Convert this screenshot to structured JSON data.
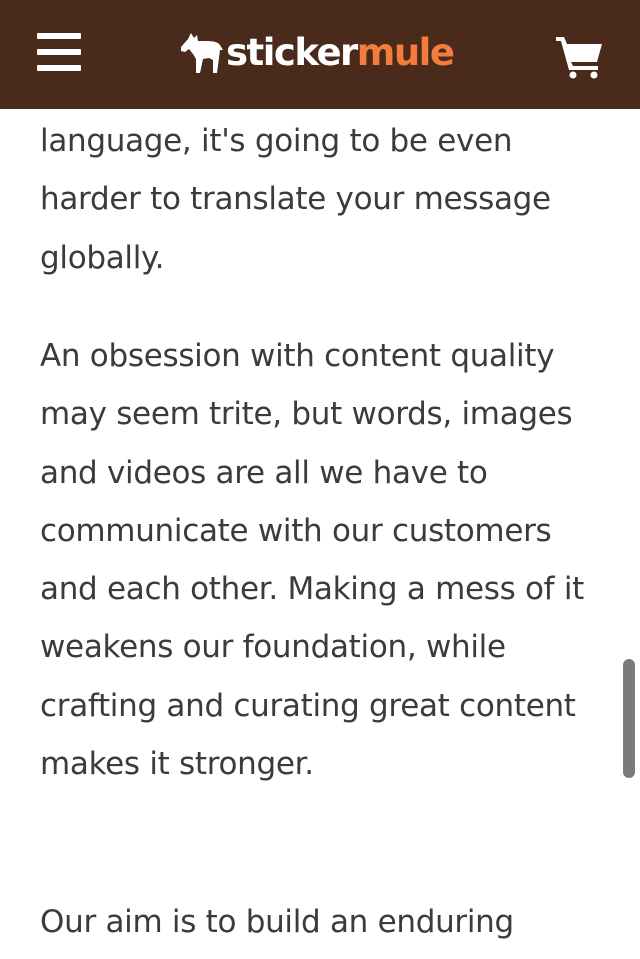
{
  "header": {
    "menu_icon": "hamburger-menu-icon",
    "logo_word_1": "sticker",
    "logo_word_2": "mule",
    "cart_icon": "shopping-cart-icon",
    "background_color": "#4a2a1b",
    "accent_color": "#f47c3c"
  },
  "article": {
    "paragraph_1": "language, it's going to be even harder to translate your message globally.",
    "paragraph_2": "An obsession with content quality may seem trite, but words, images and videos are all we have to communicate with our customers and each other. Making a mess of it weakens our foundation, while crafting and curating great content makes it stronger.",
    "paragraph_3": "Our aim is to build an enduring"
  }
}
